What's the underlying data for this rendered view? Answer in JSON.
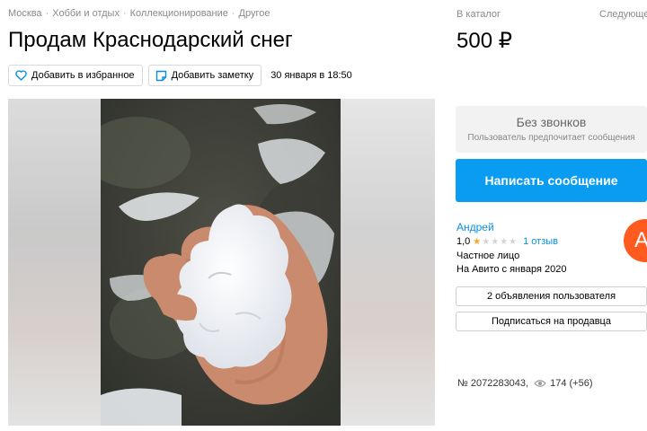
{
  "breadcrumbs": {
    "items": [
      "Москва",
      "Хобби и отдых",
      "Коллекционирование",
      "Другое"
    ],
    "separator": "·"
  },
  "listing": {
    "title": "Продам Краснодарский снег",
    "price": "500 ₽",
    "date": "30 января в 18:50",
    "id_text": "№ 2072283043,",
    "views": "174 (+56)"
  },
  "actions": {
    "favorite_label": "Добавить в избранное",
    "note_label": "Добавить заметку"
  },
  "header_right": {
    "catalog_label": "В каталог",
    "next_label": "Следующее"
  },
  "contact": {
    "no_calls_title": "Без звонков",
    "no_calls_subtitle": "Пользователь предпочитает сообщения",
    "write_button": "Написать сообщение"
  },
  "seller": {
    "name": "Андрей",
    "rating": "1,0",
    "stars_filled": 1,
    "stars_total": 5,
    "reviews": "1 отзыв",
    "type": "Частное лицо",
    "since": "На Авито с января 2020",
    "avatar_letter": "А",
    "ads_button": "2 объявления пользователя",
    "subscribe_button": "Подписаться на продавца"
  },
  "icons": {
    "favorite": "heart-icon",
    "note": "note-icon",
    "views": "eye-icon"
  },
  "colors": {
    "primary_button": "#0a9cf0",
    "link": "#0a8fe0",
    "avatar": "#ff5a1f",
    "star": "#f5a623",
    "muted_text": "#8a8a8a"
  }
}
